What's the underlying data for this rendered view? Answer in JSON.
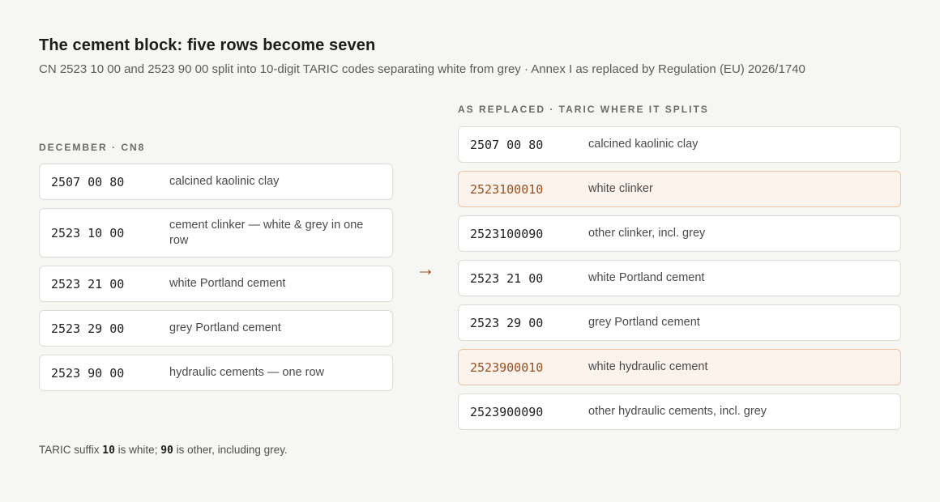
{
  "header": {
    "title": "The cement block: five rows become seven",
    "subtitle": "CN 2523 10 00 and 2523 90 00 split into 10-digit TARIC codes separating white from grey · Annex I as replaced by Regulation (EU) 2026/1740"
  },
  "left": {
    "label": "DECEMBER · CN8",
    "rows": [
      {
        "code": "2507 00 80",
        "desc": "calcined kaolinic clay"
      },
      {
        "code": "2523 10 00",
        "desc": "cement clinker — white & grey in one row"
      },
      {
        "code": "2523 21 00",
        "desc": "white Portland cement"
      },
      {
        "code": "2523 29 00",
        "desc": "grey Portland cement"
      },
      {
        "code": "2523 90 00",
        "desc": "hydraulic cements — one row"
      }
    ]
  },
  "arrow": "→",
  "right": {
    "label": "AS REPLACED · TARIC WHERE IT SPLITS",
    "rows": [
      {
        "code": "2507 00 80",
        "desc": "calcined kaolinic clay"
      },
      {
        "code": "2523100010",
        "desc": "white clinker"
      },
      {
        "code": "2523100090",
        "desc": "other clinker, incl. grey"
      },
      {
        "code": "2523 21 00",
        "desc": "white Portland cement"
      },
      {
        "code": "2523 29 00",
        "desc": "grey Portland cement"
      },
      {
        "code": "2523900010",
        "desc": "white hydraulic cement"
      },
      {
        "code": "2523900090",
        "desc": "other hydraulic cements, incl. grey"
      }
    ]
  },
  "note": {
    "prefix": "TARIC suffix ",
    "code_white": "10",
    "middle": " is white; ",
    "code_other": "90",
    "suffix": " is other, including grey."
  },
  "colors": {
    "accent": "#a0461a",
    "highlight_bg": "#fcf3ec",
    "highlight_border": "#edc3a6"
  }
}
